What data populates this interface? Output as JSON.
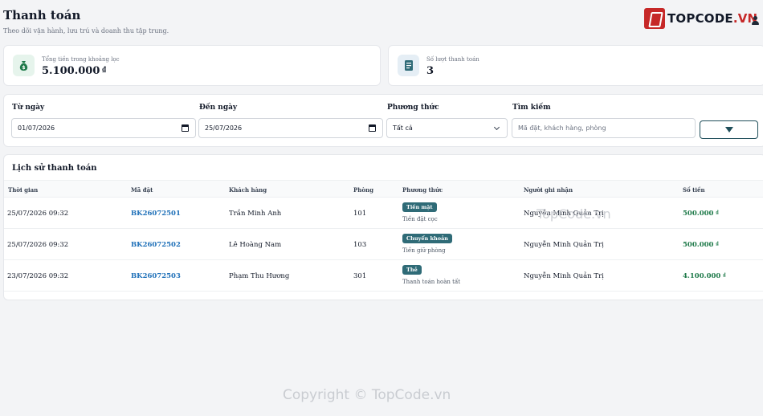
{
  "header": {
    "title": "Thanh toán",
    "subtitle": "Theo dõi vận hành, lưu trú và doanh thu tập trung."
  },
  "brand": {
    "part1": "TOPCODE",
    "part2": ".VN"
  },
  "stats": [
    {
      "label": "Tổng tiền trong khoảng lọc",
      "value": "5.100.000",
      "unit": "₫"
    },
    {
      "label": "Số lượt thanh toán",
      "value": "3"
    }
  ],
  "filters": {
    "from": {
      "label": "Từ ngày",
      "value": "01/07/2026"
    },
    "to": {
      "label": "Đến ngày",
      "value": "25/07/2026"
    },
    "method": {
      "label": "Phương thức",
      "value": "Tất cả"
    },
    "search": {
      "label": "Tìm kiếm",
      "placeholder": "Mã đặt, khách hàng, phòng"
    }
  },
  "history": {
    "title": "Lịch sử thanh toán",
    "columns": [
      "Thời gian",
      "Mã đặt",
      "Khách hàng",
      "Phòng",
      "Phương thức",
      "Người ghi nhận",
      "Số tiền"
    ],
    "rows": [
      {
        "time": "25/07/2026 09:32",
        "code": "BK26072501",
        "customer": "Trần Minh Anh",
        "room": "101",
        "method": "Tiền mặt",
        "note": "Tiền đặt cọc",
        "recorder": "Nguyễn Minh Quản Trị",
        "amount": "500.000",
        "unit": "₫"
      },
      {
        "time": "25/07/2026 09:32",
        "code": "BK26072502",
        "customer": "Lê Hoàng Nam",
        "room": "103",
        "method": "Chuyển khoản",
        "note": "Tiền giữ phòng",
        "recorder": "Nguyễn Minh Quản Trị",
        "amount": "500.000",
        "unit": "₫"
      },
      {
        "time": "23/07/2026 09:32",
        "code": "BK26072503",
        "customer": "Phạm Thu Hương",
        "room": "301",
        "method": "Thẻ",
        "note": "Thanh toán hoàn tất",
        "recorder": "Nguyễn Minh Quản Trị",
        "amount": "4.100.000",
        "unit": "₫"
      }
    ]
  },
  "watermarks": {
    "center": "TopCode.vn",
    "bottom": "Copyright © TopCode.vn"
  }
}
